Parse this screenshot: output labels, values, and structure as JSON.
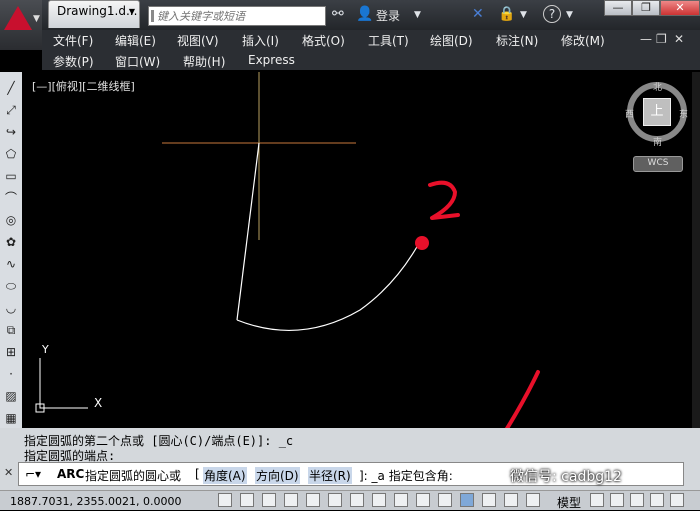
{
  "title_bar": {
    "document_tab": "Drawing1.d...",
    "search_placeholder": "键入关键字或短语",
    "login_label": "登录"
  },
  "window_controls": {
    "minimize": "—",
    "restore": "❐",
    "close": "✕"
  },
  "menus": {
    "row1": [
      "文件(F)",
      "编辑(E)",
      "视图(V)",
      "插入(I)",
      "格式(O)",
      "工具(T)",
      "绘图(D)",
      "标注(N)",
      "修改(M)"
    ],
    "row2": [
      "参数(P)",
      "窗口(W)",
      "帮助(H)",
      "Express"
    ]
  },
  "viewport": {
    "view_label": "[—][俯视][二维线框]",
    "annotation_number": "2",
    "ucs_y": "Y",
    "ucs_x": "X"
  },
  "view_cube": {
    "north": "北",
    "south": "南",
    "east": "东",
    "west": "西",
    "top": "上",
    "wcs": "WCS"
  },
  "command_history": {
    "line1": "指定圆弧的第二个点或 [圆心(C)/端点(E)]: _c",
    "line2": "指定圆弧的端点:"
  },
  "command_line": {
    "command": "ARC",
    "prompt": "指定圆弧的圆心或",
    "options": [
      "角度(A)",
      "方向(D)",
      "半径(R)"
    ],
    "suffix": "]: _a  指定包含角:",
    "bracket_open": "["
  },
  "status_bar": {
    "coordinates": "1887.7031, 2355.0021, 0.0000",
    "model_label": "模型"
  },
  "watermark": "微信号: cadbg12",
  "colors": {
    "canvas": "#000000",
    "arc": "#ffffff",
    "crosshair_h": "#c8783c",
    "crosshair_v": "#b8a060",
    "annotation_red": "#e8102a"
  }
}
